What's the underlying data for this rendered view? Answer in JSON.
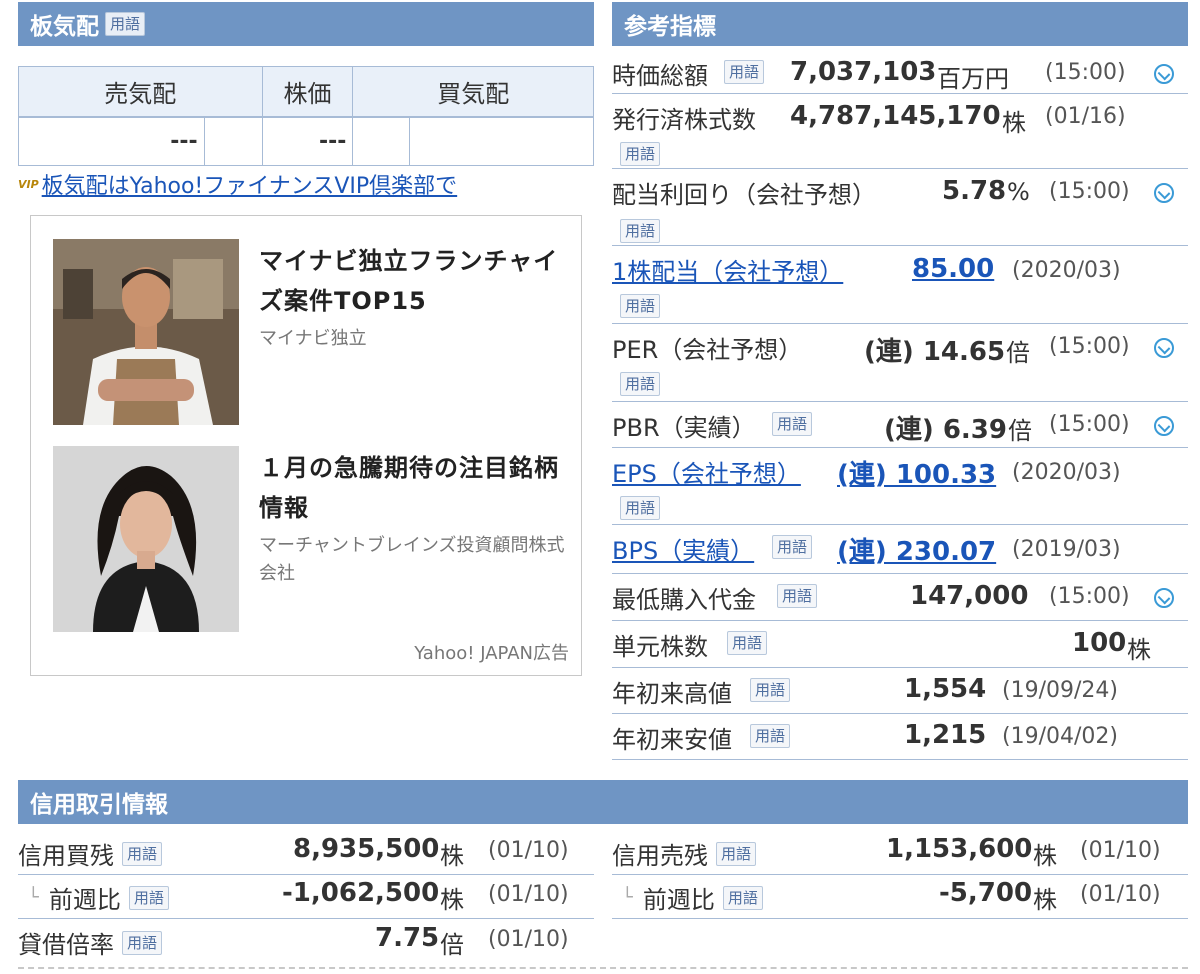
{
  "ita": {
    "title": "板気配",
    "yougo": "用語",
    "headers": [
      "売気配",
      "株価",
      "買気配"
    ],
    "sell": "---",
    "price": "---",
    "vip_badge": "VIP",
    "vip_link": "板気配はYahoo!ファイナンスVIP倶楽部で"
  },
  "ads": {
    "items": [
      {
        "title": "マイナビ独立フランチャイズ案件TOP15",
        "sponsor": "マイナビ独立",
        "image": "man-apron-photo"
      },
      {
        "title": "１月の急騰期待の注目銘柄情報",
        "sponsor": "マーチャントブレインズ投資顧問株式会社",
        "image": "woman-portrait-photo"
      }
    ],
    "credit": "Yahoo! JAPAN広告"
  },
  "indicators": {
    "title": "参考指標",
    "yougo": "用語",
    "rows": [
      {
        "label": "時価総額",
        "value": "7,037,103",
        "unit": "百万円",
        "date": "(15:00)",
        "clock": true
      },
      {
        "label": "発行済株式数",
        "value": "4,787,145,170",
        "unit": "株",
        "date": "(01/16)"
      },
      {
        "label": "配当利回り（会社予想）",
        "value": "5.78",
        "unit": "%",
        "date": "(15:00)",
        "clock": true
      },
      {
        "label": "1株配当（会社予想）",
        "value": "85.00",
        "unit": "",
        "date": "(2020/03)",
        "link": true
      },
      {
        "label": "PER（会社予想）",
        "value": "(連) 14.65",
        "unit": "倍",
        "date": "(15:00)",
        "clock": true
      },
      {
        "label": "PBR（実績）",
        "value": "(連) 6.39",
        "unit": "倍",
        "date": "(15:00)",
        "clock": true
      },
      {
        "label": "EPS（会社予想）",
        "value": "(連) 100.33",
        "unit": "",
        "date": "(2020/03)",
        "link": true
      },
      {
        "label": "BPS（実績）",
        "value": "(連) 230.07",
        "unit": "",
        "date": "(2019/03)",
        "link": true
      },
      {
        "label": "最低購入代金",
        "value": "147,000",
        "unit": "",
        "date": "(15:00)",
        "clock": true
      },
      {
        "label": "単元株数",
        "value": "100",
        "unit": "株",
        "date": ""
      },
      {
        "label": "年初来高値",
        "value": "1,554",
        "unit": "",
        "date": "(19/09/24)"
      },
      {
        "label": "年初来安値",
        "value": "1,215",
        "unit": "",
        "date": "(19/04/02)"
      }
    ]
  },
  "credit": {
    "title": "信用取引情報",
    "yougo": "用語",
    "left": [
      {
        "label": "信用買残",
        "value": "8,935,500",
        "unit": "株",
        "date": "(01/10)"
      },
      {
        "label": "前週比",
        "value": "-1,062,500",
        "unit": "株",
        "date": "(01/10)",
        "sub": true
      },
      {
        "label": "貸借倍率",
        "value": "7.75",
        "unit": "倍",
        "date": "(01/10)"
      }
    ],
    "right": [
      {
        "label": "信用売残",
        "value": "1,153,600",
        "unit": "株",
        "date": "(01/10)"
      },
      {
        "label": "前週比",
        "value": "-5,700",
        "unit": "株",
        "date": "(01/10)",
        "sub": true
      }
    ],
    "tree_glyph": "└"
  },
  "colors": {
    "header_bg": "#6f95c4",
    "link": "#1a55b8",
    "border": "#a7bbd6",
    "clock": "#3a9ad6"
  }
}
